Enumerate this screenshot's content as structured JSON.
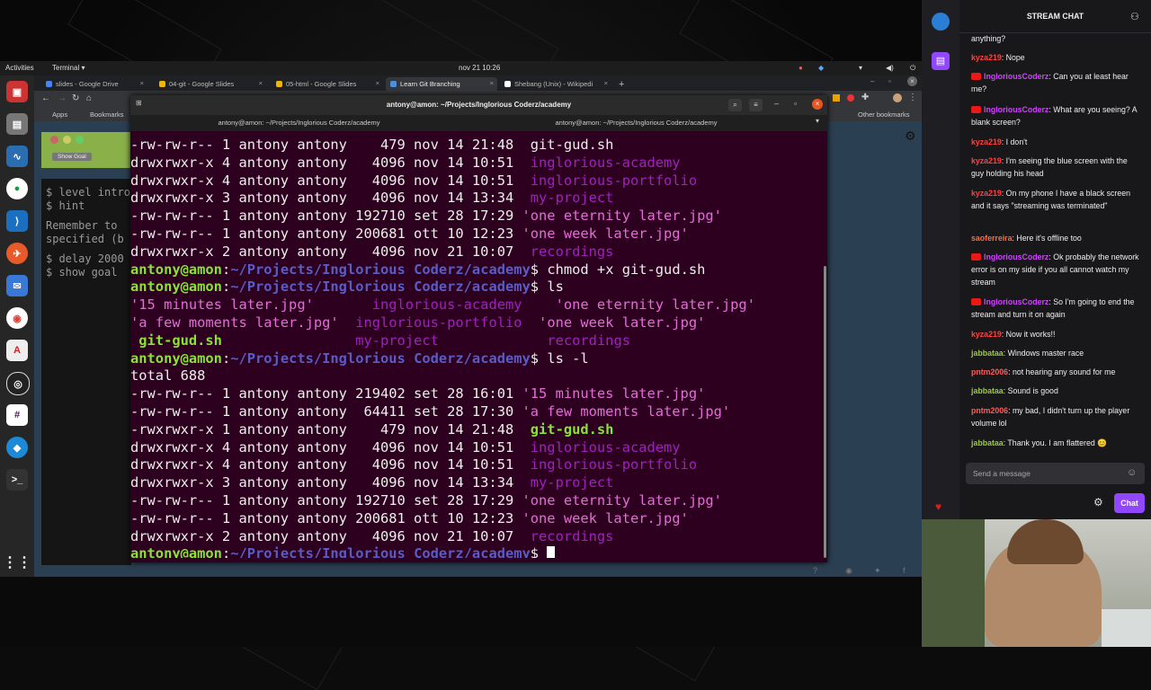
{
  "system": {
    "activities": "Activities",
    "app": "Terminal ▾",
    "clock": "nov 21  10:26"
  },
  "browser": {
    "tabs": [
      {
        "label": "slides - Google Drive",
        "color": "#4285f4"
      },
      {
        "label": "04-git - Google Slides",
        "color": "#f4b400"
      },
      {
        "label": "05-html - Google Slides",
        "color": "#f4b400"
      },
      {
        "label": "Learn Git Branching",
        "color": "#4a90e2"
      },
      {
        "label": "Shebang (Unix) - Wikipedi",
        "color": "#ffffff"
      }
    ],
    "new_tab": "+",
    "bookmarks": {
      "apps": "Apps",
      "bookmarks": "Bookmarks",
      "other": "Other bookmarks"
    },
    "page_button": "Show Goal",
    "left_lines": [
      "$ level intro",
      "$ hint",
      "Remember to",
      "specified (b",
      "$ delay 2000",
      "$ show goal"
    ],
    "prompt": "$"
  },
  "terminal": {
    "title": "antony@amon: ~/Projects/Inglorious Coderz/academy",
    "tabs": [
      "antony@amon: ~/Projects/Inglorious Coderz/academy",
      "antony@amon: ~/Projects/Inglorious Coderz/academy"
    ],
    "lines": [
      [
        {
          "t": "-rw-rw-r-- 1 antony antony    479 nov 14 21:48  ",
          "c": "w"
        },
        {
          "t": "git-gud.sh",
          "c": "w"
        }
      ],
      [
        {
          "t": "drwxrwxr-x 4 antony antony   4096 nov 14 10:51  ",
          "c": "w"
        },
        {
          "t": "inglorious-academy",
          "c": "p"
        }
      ],
      [
        {
          "t": "drwxrwxr-x 4 antony antony   4096 nov 14 10:51  ",
          "c": "w"
        },
        {
          "t": "inglorious-portfolio",
          "c": "p"
        }
      ],
      [
        {
          "t": "drwxrwxr-x 3 antony antony   4096 nov 14 13:34  ",
          "c": "w"
        },
        {
          "t": "my-project",
          "c": "p"
        }
      ],
      [
        {
          "t": "-rw-rw-r-- 1 antony antony 192710 set 28 17:29 ",
          "c": "w"
        },
        {
          "t": "'one eternity later.jpg'",
          "c": "e"
        }
      ],
      [
        {
          "t": "-rw-rw-r-- 1 antony antony 200681 ott 10 12:23 ",
          "c": "w"
        },
        {
          "t": "'one week later.jpg'",
          "c": "e"
        }
      ],
      [
        {
          "t": "drwxrwxr-x 2 antony antony   4096 nov 21 10:07  ",
          "c": "w"
        },
        {
          "t": "recordings",
          "c": "p"
        }
      ],
      [
        {
          "t": "antony@amon",
          "c": "g"
        },
        {
          "t": ":",
          "c": "w"
        },
        {
          "t": "~/Projects/Inglorious Coderz/academy",
          "c": "b"
        },
        {
          "t": "$ chmod +x git-gud.sh",
          "c": "w"
        }
      ],
      [
        {
          "t": "antony@amon",
          "c": "g"
        },
        {
          "t": ":",
          "c": "w"
        },
        {
          "t": "~/Projects/Inglorious Coderz/academy",
          "c": "b"
        },
        {
          "t": "$ ls",
          "c": "w"
        }
      ],
      [
        {
          "t": "'15 minutes later.jpg'       ",
          "c": "e"
        },
        {
          "t": "inglorious-academy    ",
          "c": "p"
        },
        {
          "t": "'one eternity later.jpg'",
          "c": "e"
        }
      ],
      [
        {
          "t": "'a few moments later.jpg'  ",
          "c": "e"
        },
        {
          "t": "inglorious-portfolio  ",
          "c": "p"
        },
        {
          "t": "'one week later.jpg'",
          "c": "e"
        }
      ],
      [
        {
          "t": " git-gud.sh                ",
          "c": "g"
        },
        {
          "t": "my-project             ",
          "c": "p"
        },
        {
          "t": "recordings",
          "c": "p"
        }
      ],
      [
        {
          "t": "antony@amon",
          "c": "g"
        },
        {
          "t": ":",
          "c": "w"
        },
        {
          "t": "~/Projects/Inglorious Coderz/academy",
          "c": "b"
        },
        {
          "t": "$ ls -l",
          "c": "w"
        }
      ],
      [
        {
          "t": "total 688",
          "c": "w"
        }
      ],
      [
        {
          "t": "-rw-rw-r-- 1 antony antony 219402 set 28 16:01 ",
          "c": "w"
        },
        {
          "t": "'15 minutes later.jpg'",
          "c": "e"
        }
      ],
      [
        {
          "t": "-rw-rw-r-- 1 antony antony  64411 set 28 17:30 ",
          "c": "w"
        },
        {
          "t": "'a few moments later.jpg'",
          "c": "e"
        }
      ],
      [
        {
          "t": "-rwxrwxr-x 1 antony antony    479 nov 14 21:48  ",
          "c": "w"
        },
        {
          "t": "git-gud.sh",
          "c": "g"
        }
      ],
      [
        {
          "t": "drwxrwxr-x 4 antony antony   4096 nov 14 10:51  ",
          "c": "w"
        },
        {
          "t": "inglorious-academy",
          "c": "p"
        }
      ],
      [
        {
          "t": "drwxrwxr-x 4 antony antony   4096 nov 14 10:51  ",
          "c": "w"
        },
        {
          "t": "inglorious-portfolio",
          "c": "p"
        }
      ],
      [
        {
          "t": "drwxrwxr-x 3 antony antony   4096 nov 14 13:34  ",
          "c": "w"
        },
        {
          "t": "my-project",
          "c": "p"
        }
      ],
      [
        {
          "t": "-rw-rw-r-- 1 antony antony 192710 set 28 17:29 ",
          "c": "w"
        },
        {
          "t": "'one eternity later.jpg'",
          "c": "e"
        }
      ],
      [
        {
          "t": "-rw-rw-r-- 1 antony antony 200681 ott 10 12:23 ",
          "c": "w"
        },
        {
          "t": "'one week later.jpg'",
          "c": "e"
        }
      ],
      [
        {
          "t": "drwxrwxr-x 2 antony antony   4096 nov 21 10:07  ",
          "c": "w"
        },
        {
          "t": "recordings",
          "c": "p"
        }
      ],
      [
        {
          "t": "antony@amon",
          "c": "g"
        },
        {
          "t": ":",
          "c": "w"
        },
        {
          "t": "~/Projects/Inglorious Coderz/academy",
          "c": "b"
        },
        {
          "t": "$ ",
          "c": "w"
        }
      ]
    ]
  },
  "chat": {
    "header": "STREAM CHAT",
    "messages": [
      {
        "user": "",
        "color": "#efeff1",
        "text": "anything?",
        "badge": false
      },
      {
        "user": "kyza219",
        "color": "#ff4040",
        "text": ": Nope",
        "badge": false
      },
      {
        "user": "IngloriousCoderz",
        "color": "#d041ff",
        "text": ": Can you at least hear me?",
        "badge": true
      },
      {
        "user": "IngloriousCoderz",
        "color": "#d041ff",
        "text": ": What are you seeing? A blank screen?",
        "badge": true
      },
      {
        "user": "kyza219",
        "color": "#ff4040",
        "text": ": I don't",
        "badge": false
      },
      {
        "user": "kyza219",
        "color": "#ff4040",
        "text": ": I'm seeing the blue screen with the guy holding his head",
        "badge": false
      },
      {
        "user": "kyza219",
        "color": "#ff4040",
        "text": ": On my phone I have a black screen and it says \"streaming was terminated\"",
        "badge": false
      },
      {
        "user": "saoferreira",
        "color": "#ff6a3d",
        "text": ": Here it's offline too",
        "badge": false
      },
      {
        "user": "IngloriousCoderz",
        "color": "#d041ff",
        "text": ": Ok probably the network error is on my side if you all cannot watch my stream",
        "badge": true
      },
      {
        "user": "IngloriousCoderz",
        "color": "#d041ff",
        "text": ": So I'm going to end the stream and turn it on again",
        "badge": true
      },
      {
        "user": "kyza219",
        "color": "#ff4040",
        "text": ": Now it works!!",
        "badge": false
      },
      {
        "user": "jabbataa",
        "color": "#9acd32",
        "text": ": Windows master race",
        "badge": false
      },
      {
        "user": "pntm2006",
        "color": "#ff5a5a",
        "text": ": not hearing any sound for me",
        "badge": false
      },
      {
        "user": "jabbataa",
        "color": "#9acd32",
        "text": ": Sound is good",
        "badge": false
      },
      {
        "user": "pntm2006",
        "color": "#ff5a5a",
        "text": ": my bad, I didn't turn up the player volume lol",
        "badge": false
      },
      {
        "user": "jabbataa",
        "color": "#9acd32",
        "text": ": Thank you. I am flattered 😊",
        "badge": false
      }
    ],
    "input_placeholder": "Send a message",
    "send_label": "Chat"
  }
}
